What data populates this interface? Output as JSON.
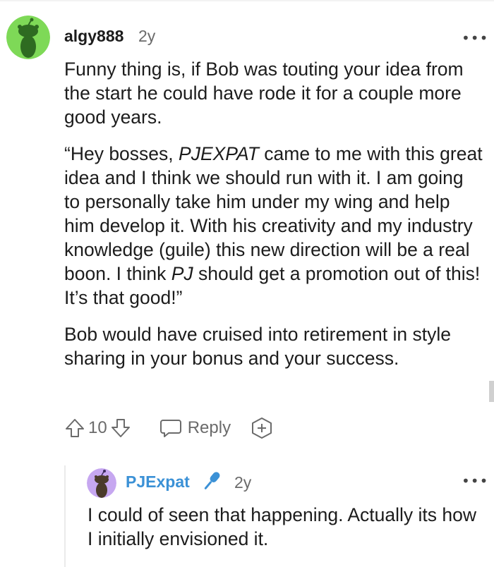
{
  "comment": {
    "username": "algy888",
    "age": "2y",
    "more_label": "•••",
    "paragraph1": "Funny thing is, if Bob was touting your idea from the start he could have rode it for a couple more good years.",
    "paragraph2": {
      "part1": "“Hey bosses, ",
      "emph1": "PJEXPAT",
      "part2": " came to me with this great idea and I think we should run with it. I am going to personally take him under my wing and help him develop it. With his creativity and my industry knowledge (guile) this new direction will be a real boon. I think ",
      "emph2": "PJ",
      "part3": " should get a promotion out of this! It’s that good!”"
    },
    "paragraph3": "Bob would have cruised into retirement in style sharing in your bonus and your success.",
    "vote_count": "10",
    "reply_label": "Reply",
    "avatar_color": "#7ed957"
  },
  "reply": {
    "username": "PJExpat",
    "age": "2y",
    "more_label": "•••",
    "text": "I could of seen that happening. Actually its how I initially envisioned it.",
    "avatar_color": "#c6a7f0",
    "username_color": "#3b91d6",
    "badge_icon": "microphone-icon"
  }
}
